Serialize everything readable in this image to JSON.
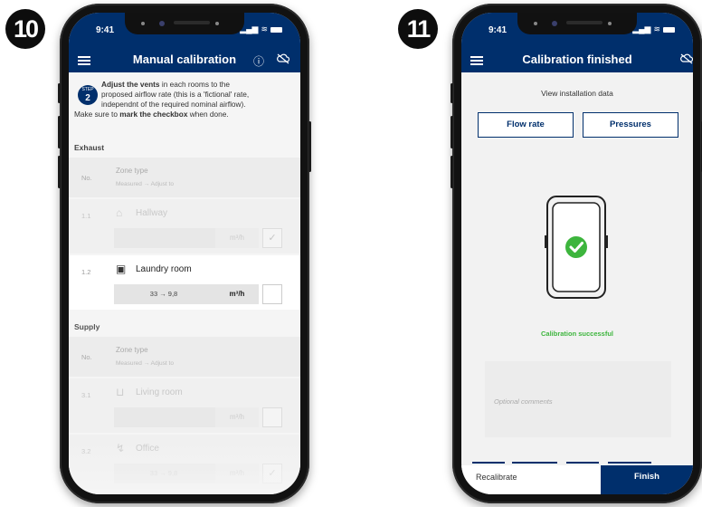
{
  "steps": {
    "left_number": "10",
    "right_number": "11"
  },
  "status": {
    "time": "9:41"
  },
  "manual": {
    "title": "Manual calibration",
    "step_label": "STEP",
    "step_number": "2",
    "instr_bold1": "Adjust the vents",
    "instr_line1": " in each rooms to the",
    "instr_line2": "proposed airflow rate (this is a 'fictional' rate,",
    "instr_line3": "independnt of the required nominal airflow).",
    "instr_line4_a": "Make sure to ",
    "instr_line4_b": "mark the checkbox",
    "instr_line4_c": " when done.",
    "exhaust_label": "Exhaust",
    "supply_label": "Supply",
    "header_no": "No.",
    "header_zone": "Zone type",
    "header_measured": "Measured → Adjust to",
    "unit": "m³/h",
    "rows": [
      {
        "num": "1.1",
        "name": "Hallway",
        "value": "",
        "checked": "✓"
      },
      {
        "num": "1.2",
        "name": "Laundry room",
        "value": "33 → 9,8",
        "checked": ""
      },
      {
        "num": "3.1",
        "name": "Living room",
        "value": "",
        "checked": ""
      },
      {
        "num": "3.2",
        "name": "Office",
        "value": "33 → 9,8",
        "checked": "✓"
      }
    ]
  },
  "finished": {
    "title": "Calibration finished",
    "view_data": "View installation data",
    "btn_flow": "Flow rate",
    "btn_pressures": "Pressures",
    "success_text": "Calibration successful",
    "comments_placeholder": "Optional comments",
    "recalibrate": "Recalibrate",
    "finish": "Finish"
  },
  "colors": {
    "brand": "#002f6c",
    "success": "#3db53d"
  }
}
